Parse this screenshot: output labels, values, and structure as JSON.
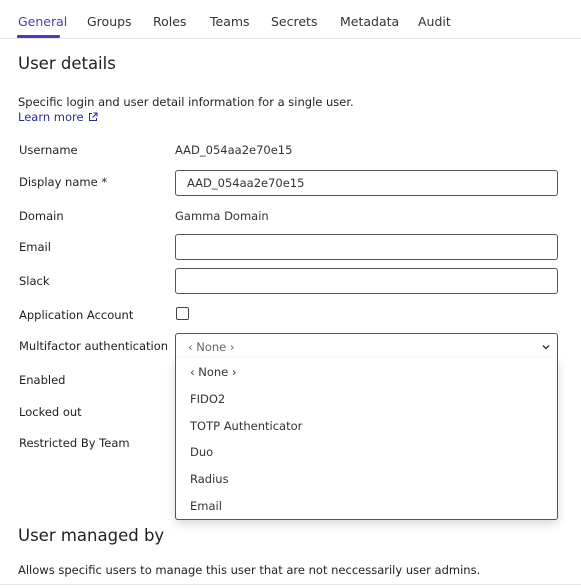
{
  "tabs": [
    {
      "label": "General",
      "active": true
    },
    {
      "label": "Groups"
    },
    {
      "label": "Roles"
    },
    {
      "label": "Teams"
    },
    {
      "label": "Secrets"
    },
    {
      "label": "Metadata"
    },
    {
      "label": "Audit"
    }
  ],
  "user_details": {
    "title": "User details",
    "description": "Specific login and user detail information for a single user.",
    "learn_more": "Learn more"
  },
  "fields": {
    "username": {
      "label": "Username",
      "value": "AAD_054aa2e70e15"
    },
    "display_name": {
      "label": "Display name *",
      "value": "AAD_054aa2e70e15"
    },
    "domain": {
      "label": "Domain",
      "value": "Gamma Domain"
    },
    "email": {
      "label": "Email",
      "value": ""
    },
    "slack": {
      "label": "Slack",
      "value": ""
    },
    "application_account": {
      "label": "Application Account",
      "checked": false
    },
    "mfa": {
      "label": "Multifactor authentication",
      "selected": "‹ None ›"
    },
    "enabled": {
      "label": "Enabled"
    },
    "locked_out": {
      "label": "Locked out"
    },
    "restricted_by_team": {
      "label": "Restricted By Team"
    }
  },
  "mfa_options": [
    "‹ None ›",
    "FIDO2",
    "TOTP Authenticator",
    "Duo",
    "Radius",
    "Email"
  ],
  "user_managed_by": {
    "title": "User managed by",
    "description": "Allows specific users to manage this user that are not neccessarily user admins."
  },
  "colors": {
    "accent": "#4a3fa8",
    "link": "#2a2f8f",
    "button": "#2d2a6e"
  },
  "icons": {
    "learn_more": "external-link-icon",
    "mfa_select": "chevron-down-icon"
  }
}
